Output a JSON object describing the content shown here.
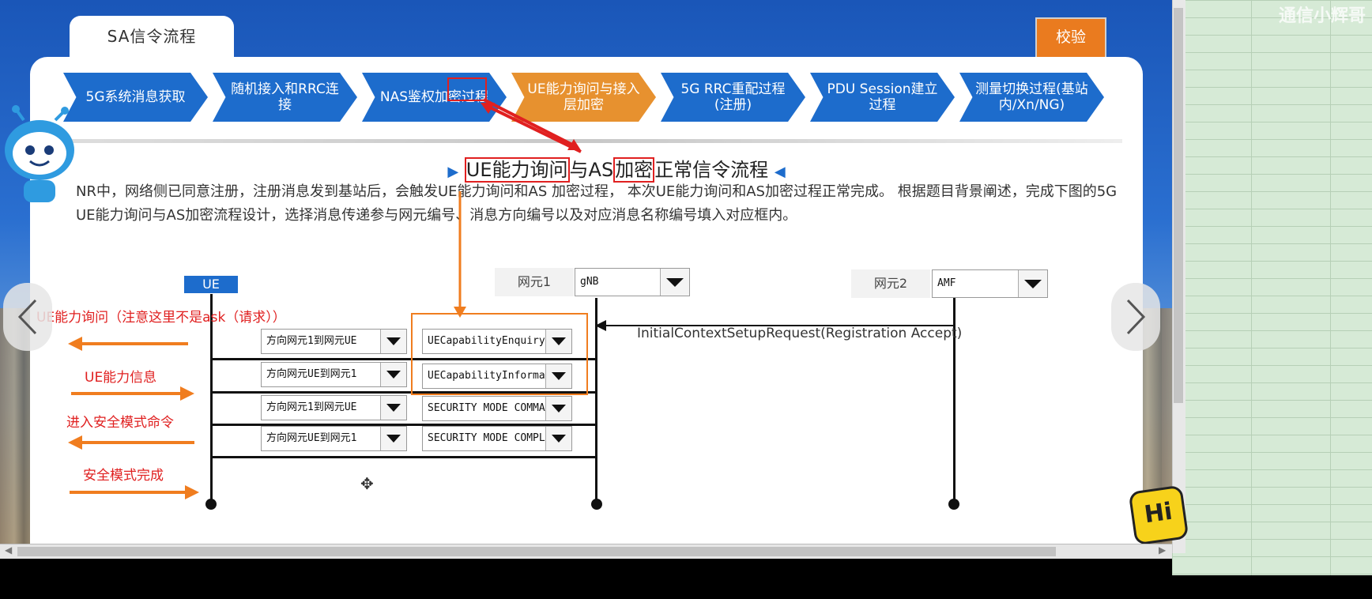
{
  "watermark": "通信小辉哥",
  "tab": {
    "label": "SA信令流程"
  },
  "verify_button": "校验",
  "steps": [
    {
      "label": "5G系统消息获取",
      "active": false
    },
    {
      "label": "随机接入和RRC连接",
      "active": false
    },
    {
      "label": "NAS鉴权加密过程",
      "active": false
    },
    {
      "label": "UE能力询问与接入层加密",
      "active": true
    },
    {
      "label": "5G RRC重配过程(注册)",
      "active": false
    },
    {
      "label": "PDU Session建立过程",
      "active": false
    },
    {
      "label": "测量切换过程(基站内/Xn/NG)",
      "active": false
    }
  ],
  "heading": {
    "part1": "UE能力询问",
    "part2": "与AS",
    "part3": "加密",
    "part4": "正常信令流程"
  },
  "description": "NR中，网络侧已同意注册，注册消息发到基站后，会触发UE能力询问和AS 加密过程， 本次UE能力询问和AS加密过程正常完成。 根据题目背景阐述，完成下图的5G UE能力询问与AS加密流程设计，选择消息传递参与网元编号、消息方向编号以及对应消息名称编号填入对应框内。",
  "diagram": {
    "ue_label": "UE",
    "ne1": {
      "label": "网元1",
      "value": "gNB"
    },
    "ne2": {
      "label": "网元2",
      "value": "AMF"
    },
    "incoming_message": "InitialContextSetupRequest(Registration Accept)",
    "rows": [
      {
        "direction": "方向网元1到网元UE",
        "message": "UECapabilityEnquiry"
      },
      {
        "direction": "方向网元UE到网元1",
        "message": "UECapabilityInforma"
      },
      {
        "direction": "方向网元1到网元UE",
        "message": "SECURITY MODE COMMA"
      },
      {
        "direction": "方向网元UE到网元1",
        "message": "SECURITY MODE COMPL"
      }
    ]
  },
  "notes": {
    "note1": "UE能力询问（注意这里不是ask（请求））",
    "note2": "UE能力信息",
    "note3": "进入安全模式命令",
    "note4": "安全模式完成"
  },
  "hi_badge": "Hi",
  "colors": {
    "step_blue": "#1d6ccc",
    "step_active": "#e7912f",
    "verify": "#ea7b1f",
    "annotation_red": "#e02020",
    "annotation_orange": "#f07d1f"
  }
}
